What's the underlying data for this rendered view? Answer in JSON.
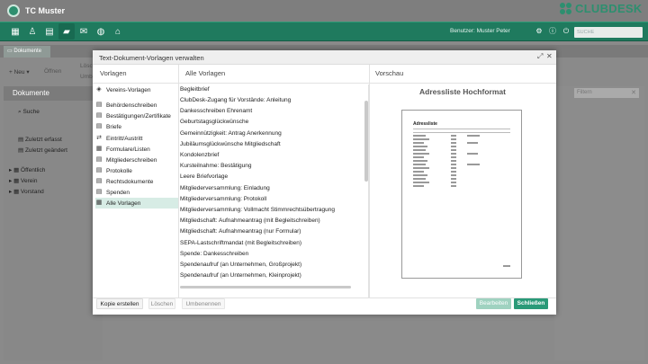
{
  "app": {
    "title": "TC Muster",
    "brand": "CLUBDESK"
  },
  "navbar": {
    "icons": [
      "grid-icon",
      "person-icon",
      "calendar-icon",
      "folder-icon",
      "mail-icon",
      "globe-icon",
      "bank-icon"
    ],
    "user_label": "Benutzer: Muster Peter",
    "search_placeholder": "SUCHE"
  },
  "tabs": {
    "documents": "Dokumente"
  },
  "toolbar": {
    "new_label": "Neu",
    "open_label": "Öffnen",
    "delete_partial": "Lösc",
    "rename_partial": "Umb"
  },
  "left_panel": {
    "header": "Dokumente",
    "search": "Suche",
    "recent_captured": "Zuletzt erfasst",
    "recent_changed": "Zuletzt geändert",
    "folders": [
      "Öffentlich",
      "Verein",
      "Vorstand"
    ]
  },
  "filter_placeholder": "Filtern",
  "dialog": {
    "title": "Text-Dokument-Vorlagen verwalten",
    "col_templates": "Vorlagen",
    "col_all": "Alle Vorlagen",
    "col_preview": "Vorschau",
    "categories": [
      {
        "label": "Vereins-Vorlagen",
        "icon": "club-icon"
      },
      {
        "label": "Behördenschreiben",
        "icon": "document-icon"
      },
      {
        "label": "Bestätigungen/Zertifikate",
        "icon": "document-icon"
      },
      {
        "label": "Briefe",
        "icon": "document-icon"
      },
      {
        "label": "Eintritt/Austritt",
        "icon": "arrows-icon"
      },
      {
        "label": "Formulare/Listen",
        "icon": "form-icon"
      },
      {
        "label": "Mitgliederschreiben",
        "icon": "document-icon"
      },
      {
        "label": "Protokolle",
        "icon": "document-icon"
      },
      {
        "label": "Rechtsdokumente",
        "icon": "document-icon"
      },
      {
        "label": "Spenden",
        "icon": "document-icon"
      },
      {
        "label": "Alle Vorlagen",
        "icon": "grid-icon"
      }
    ],
    "templates": [
      "Begleitbrief",
      "ClubDesk-Zugang für Vorstände: Anleitung",
      "Dankesschreiben Ehrenamt",
      "Geburtstagsglückwünsche",
      "Gemeinnützigkeit: Antrag Anerkennung",
      "Jubiläumsglückwünsche Mitgliedschaft",
      "Kondolenzbrief",
      "Kursteilnahme: Bestätigung",
      "Leere Briefvorlage",
      "Mitgliederversammlung: Einladung",
      "Mitgliederversammlung: Protokoll",
      "Mitgliederversammlung: Vollmacht Stimmrechtsübertragung",
      "Mitgliedschaft: Aufnahmeantrag (mit Begleitschreiben)",
      "Mitgliedschaft: Aufnahmeantrag (nur Formular)",
      "SEPA-Lastschriftmandat (mit Begleitschreiben)",
      "Spende: Dankesschreiben",
      "Spendenaufruf (an Unternehmen, Großprojekt)",
      "Spendenaufruf (an Unternehmen, Kleinprojekt)"
    ],
    "preview_title": "Adressliste Hochformat",
    "preview_doc_title": "Adressliste",
    "buttons": {
      "copy": "Kopie erstellen",
      "delete": "Löschen",
      "rename": "Umbenennen",
      "edit": "Bearbeiten",
      "close": "Schließen"
    }
  },
  "colors": {
    "accent": "#2a9a78",
    "navbar": "#1f7a5e",
    "selection": "#d7ece5"
  }
}
